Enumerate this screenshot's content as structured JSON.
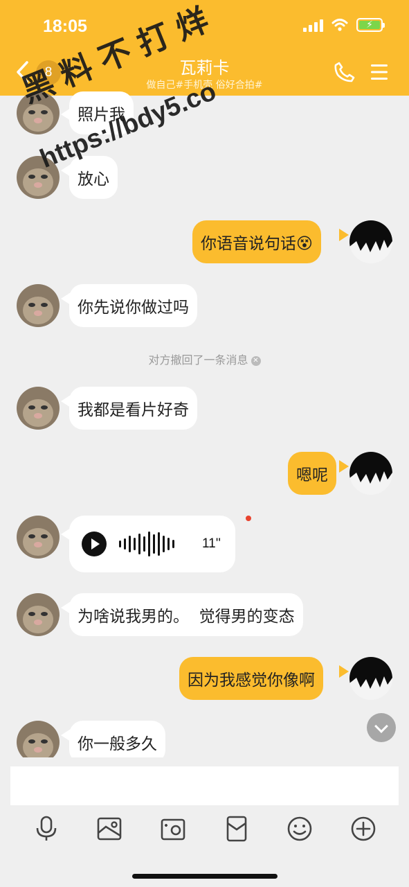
{
  "status_bar": {
    "time": "18:05"
  },
  "header": {
    "unread_count": "8",
    "contact_name": "瓦莉卡",
    "contact_subtitle": "做自己#手机壳 俗好合拍#"
  },
  "watermark": {
    "line1": "黑料不打烊",
    "line2": "https://bdy5.co"
  },
  "messages": [
    {
      "side": "in",
      "text": "照片我"
    },
    {
      "side": "in",
      "text": "放心"
    },
    {
      "side": "out",
      "text": "你语音说句话😵"
    },
    {
      "side": "in",
      "text": "你先说你做过吗"
    },
    {
      "side": "in",
      "text": "我都是看片好奇"
    },
    {
      "side": "out",
      "text": "嗯呢"
    },
    {
      "side": "in",
      "text": "为啥说我男的。  觉得男的变态"
    },
    {
      "side": "out",
      "text": "因为我感觉你像啊"
    },
    {
      "side": "in",
      "text": "你一般多久"
    }
  ],
  "recall_notice": "对方撤回了一条消息",
  "voice_message": {
    "duration": "11''"
  },
  "input": {
    "placeholder": ""
  },
  "toolbar": [
    "microphone-icon",
    "image-icon",
    "camera-icon",
    "red-packet-icon",
    "emoji-icon",
    "plus-icon"
  ],
  "colors": {
    "accent": "#fbbc2e",
    "background": "#efefef",
    "incoming_bubble": "#ffffff"
  }
}
